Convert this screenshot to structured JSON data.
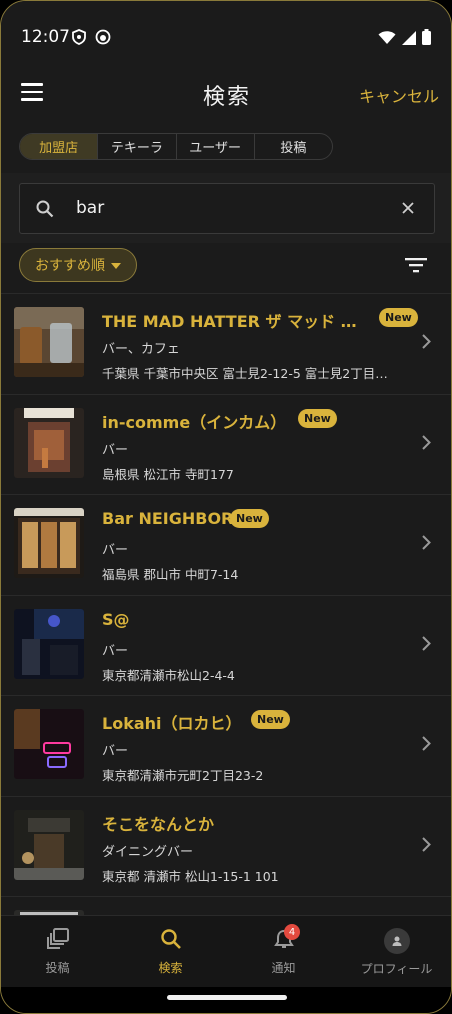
{
  "status_bar": {
    "time": "12:07"
  },
  "header": {
    "title": "検索",
    "cancel_label": "キャンセル"
  },
  "tabs": [
    {
      "label": "加盟店",
      "active": true
    },
    {
      "label": "テキーラ",
      "active": false
    },
    {
      "label": "ユーザー",
      "active": false
    },
    {
      "label": "投稿",
      "active": false
    }
  ],
  "search": {
    "value": "bar"
  },
  "sort": {
    "label": "おすすめ順"
  },
  "results": [
    {
      "name": "THE MAD HATTER ザ マッド …",
      "category": "バー、カフェ",
      "address": "千葉県 千葉市中央区 富士見2-12-5 富士見2丁目…",
      "is_new": true,
      "new_label": "New"
    },
    {
      "name": "in-comme（インカム）",
      "category": "バー",
      "address": "島根県 松江市 寺町177",
      "is_new": true,
      "new_label": "New"
    },
    {
      "name": "Bar NEIGHBOR",
      "category": "バー",
      "address": "福島県 郡山市 中町7-14",
      "is_new": true,
      "new_label": "New"
    },
    {
      "name": "S@",
      "category": "バー",
      "address": "東京都清瀬市松山2-4-4",
      "is_new": false,
      "new_label": ""
    },
    {
      "name": "Lokahi（ロカヒ）",
      "category": "バー",
      "address": "東京都清瀬市元町2丁目23-2",
      "is_new": true,
      "new_label": "New"
    },
    {
      "name": "そこをなんとか",
      "category": "ダイニングバー",
      "address": "東京都 清瀬市 松山1-15-1 101",
      "is_new": false,
      "new_label": ""
    }
  ],
  "bottom_nav": {
    "posts_label": "投稿",
    "search_label": "検索",
    "notifications_label": "通知",
    "notification_count": "4",
    "profile_label": "プロフィール"
  },
  "colors": {
    "accent": "#d9b33c",
    "background": "#1b1b1b",
    "badge_red": "#e34a3f"
  }
}
